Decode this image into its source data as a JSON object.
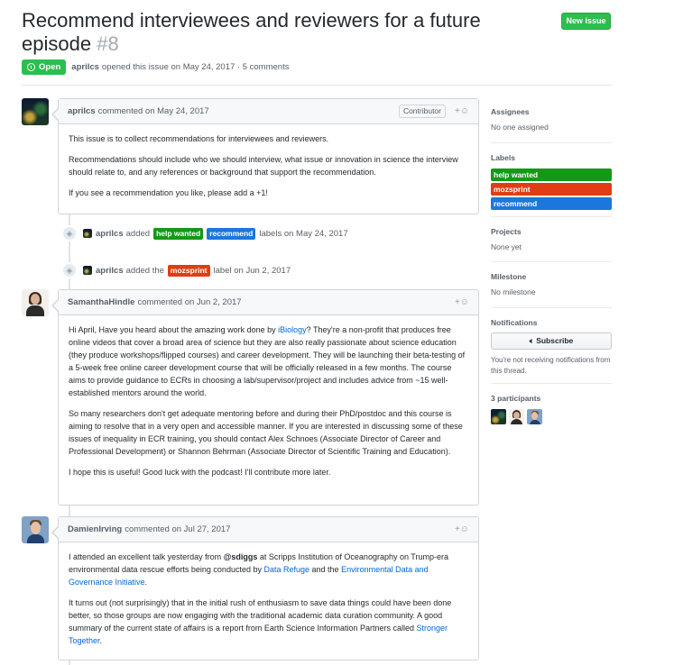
{
  "issue": {
    "title": "Recommend interviewees and reviewers for a future episode",
    "number": "#8",
    "state": "Open",
    "author": "aprilcs",
    "meta_text": "opened this issue on May 24, 2017 · 5 comments",
    "new_issue_label": "New issue"
  },
  "comments": [
    {
      "author": "aprilcs",
      "when": "commented on May 24, 2017",
      "badge": "Contributor",
      "paragraphs": [
        "This issue is to collect recommendations for interviewees and reviewers.",
        "Recommendations should include who we should interview, what issue or innovation in science the interview should relate to, and any references or background that support the recommendation.",
        "If you see a recommendation you like, please add a +1!"
      ]
    },
    {
      "author": "SamanthaHindle",
      "when": "commented on Jun 2, 2017",
      "p1_before": "Hi April, Have you heard about the amazing work done by ",
      "p1_link": "iBiology",
      "p1_after": "? They're a non-profit that produces free online videos that cover a broad area of science but they are also really passionate about science education (they produce workshops/flipped courses) and career development. They will be launching their beta-testing of a 5-week free online career development course that will be officially released in a few months. The course aims to provide guidance to ECRs in choosing a lab/supervisor/project and includes advice from ~15 well-established mentors around the world.",
      "p2": "So many researchers don't get adequate mentoring before and during their PhD/postdoc and this course is aiming to resolve that in a very open and accessible manner. If you are interested in discussing some of these issues of inequality in ECR training, you should contact Alex Schnoes (Associate Director of Career and Professional Development) or Shannon Behrman (Associate Director of Scientific Training and Education).",
      "p3": "I hope this is useful! Good luck with the podcast! I'll contribute more later."
    },
    {
      "author": "DamienIrving",
      "when": "commented on Jul 27, 2017",
      "p1_a": "I attended an excellent talk yesterday from ",
      "p1_mention": "@sdiggs",
      "p1_b": " at Scripps Institution of Oceanography on Trump-era environmental data rescue efforts being conducted by ",
      "p1_link1": "Data Refuge",
      "p1_c": " and the ",
      "p1_link2": "Environmental Data and Governance Initiative",
      "p1_d": ".",
      "p2_a": "It turns out (not surprisingly) that in the initial rush of enthusiasm to save data things could have been done better, so those groups are now engaging with the traditional academic data curation community. A good summary of the current state of affairs is a report from Earth Science Information Partners called ",
      "p2_link": "Stronger Together",
      "p2_b": "."
    }
  ],
  "events": [
    {
      "actor": "aprilcs",
      "verb": "added",
      "labels": [
        "help wanted",
        "recommend"
      ],
      "suffix": "labels on May 24, 2017"
    },
    {
      "actor": "aprilcs",
      "verb": "added the",
      "labels": [
        "mozsprint"
      ],
      "suffix": "label on Jun 2, 2017"
    }
  ],
  "sidebar": {
    "assignees": {
      "heading": "Assignees",
      "value": "No one assigned"
    },
    "labels": {
      "heading": "Labels",
      "items": [
        "help wanted",
        "mozsprint",
        "recommend"
      ]
    },
    "projects": {
      "heading": "Projects",
      "value": "None yet"
    },
    "milestone": {
      "heading": "Milestone",
      "value": "No milestone"
    },
    "notifications": {
      "heading": "Notifications",
      "button": "Subscribe",
      "note": "You're not receiving notifications from this thread."
    },
    "participants": {
      "heading": "3 participants"
    }
  },
  "colors": {
    "help_wanted": "#159818",
    "mozsprint": "#e13d14",
    "recommend": "#1d76db",
    "open": "#2cbe4e",
    "link": "#0366d6"
  },
  "icons": [
    "issue-opened-icon",
    "tag-icon",
    "smiley-icon",
    "unmute-icon"
  ]
}
